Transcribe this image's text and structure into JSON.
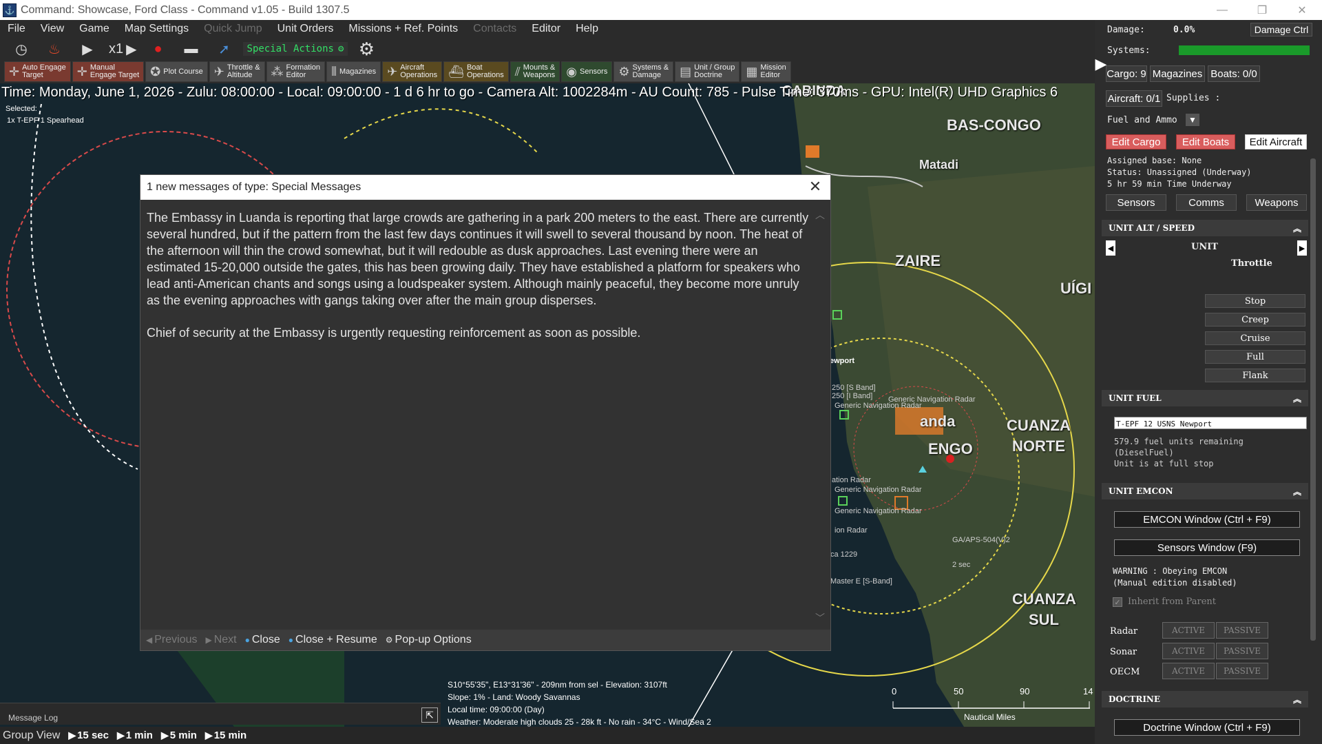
{
  "window": {
    "title": "Command: Showcase, Ford Class - Command v1.05 - Build 1307.5",
    "minimize": "—",
    "maximize": "❐",
    "close": "✕"
  },
  "menu": [
    "File",
    "View",
    "Game",
    "Map Settings",
    "Quick Jump",
    "Unit Orders",
    "Missions + Ref. Points",
    "Contacts",
    "Editor",
    "Help"
  ],
  "toolbar": {
    "speed": "x1",
    "special_actions": "Special Actions"
  },
  "toolbar2": [
    {
      "label1": "Auto Engage",
      "label2": "Target",
      "style": "red"
    },
    {
      "label1": "Manual",
      "label2": "Engage Target",
      "style": "red"
    },
    {
      "label1": "Plot Course",
      "label2": "",
      "style": ""
    },
    {
      "label1": "Throttle &",
      "label2": "Altitude",
      "style": ""
    },
    {
      "label1": "Formation",
      "label2": "Editor",
      "style": ""
    },
    {
      "label1": "Magazines",
      "label2": "",
      "style": ""
    },
    {
      "label1": "Aircraft",
      "label2": "Operations",
      "style": "gold"
    },
    {
      "label1": "Boat",
      "label2": "Operations",
      "style": "gold"
    },
    {
      "label1": "Mounts &",
      "label2": "Weapons",
      "style": "green"
    },
    {
      "label1": "Sensors",
      "label2": "",
      "style": "green"
    },
    {
      "label1": "Systems &",
      "label2": "Damage",
      "style": ""
    },
    {
      "label1": "Unit / Group",
      "label2": "Doctrine",
      "style": ""
    },
    {
      "label1": "Mission",
      "label2": "Editor",
      "style": ""
    }
  ],
  "status_line": "Time: Monday, June 1, 2026 - Zulu: 08:00:00 - Local: 09:00:00 - 1 d 6 hr to go -  Camera Alt: 1002284m  - AU Count: 785 - Pulse Time: 370ms - GPU: Intel(R) UHD Graphics 6",
  "selected": {
    "label": "Selected:",
    "unit": "1x T-EPF 1 Spearhead"
  },
  "map_labels": {
    "cabinda": "CABINDA",
    "bas_congo": "BAS-CONGO",
    "matadi": "Matadi",
    "zaire": "ZAIRE",
    "uige": "UÍGI",
    "cuanza_norte_1": "CUANZA",
    "cuanza_norte_2": "NORTE",
    "cuanza_sul_1": "CUANZA",
    "cuanza_sul_2": "SUL",
    "luanda": "anda",
    "bengo": "ENGO",
    "newport": "ewport",
    "band1": "250 [S Band]",
    "band2": "250 [I Band]",
    "gen_radar1": "Generic Navigation Radar",
    "gen_radar2": "Generic Navigation Radar",
    "nav_radar": "ation Radar",
    "gen_radar3": "Generic Navigation Radar",
    "gen_radar4": "Generic Navigation Radar",
    "gen_radar5": "ion Radar",
    "ca1229": "ca 1229",
    "masterE": "Master E [S-Band]",
    "aps": "GA/APS-504(V)2",
    "two_sec": "2 sec",
    "nautical": "Nautical Miles"
  },
  "scale": {
    "t0": "0",
    "t1": "50",
    "t2": "90",
    "t3": "14"
  },
  "cursor_info": [
    "S10°55'35\", E13°31'36\" - 209nm from sel - Elevation: 3107ft",
    "Slope: 1%  - Land: Woody Savannas",
    "Local time: 09:00:00 (Day)",
    "Weather: Moderate high clouds 25 - 28k ft - No rain - 34°C - Wind/Sea 2"
  ],
  "message_log": "Message Log",
  "timebar": {
    "group_view": "Group View",
    "steps": [
      "15 sec",
      "1 min",
      "5 min",
      "15 min"
    ]
  },
  "dialog": {
    "title": "1 new messages of type: Special Messages",
    "para1": "The Embassy in Luanda is reporting that large crowds are gathering in a park 200 meters to the east. There are currently several hundred, but if the pattern from the last few days continues it will swell to several thousand by noon. The heat of the afternoon will thin the crowd somewhat, but it will redouble as dusk approaches. Last evening there were an estimated 15-20,000 outside the gates, this has been growing daily. They have established a platform for speakers who lead anti-American chants and songs using a loudspeaker system. Although mainly peaceful, they become more unruly as the evening approaches with gangs taking over after the main group disperses.",
    "para2": "Chief of security at the Embassy is urgently requesting reinforcement as soon as possible.",
    "previous": "Previous",
    "next": "Next",
    "close": "Close",
    "close_resume": "Close + Resume",
    "popup_options": "Pop-up Options"
  },
  "panel": {
    "damage_label": "Damage:",
    "damage_value": "0.0%",
    "damage_ctrl": "Damage Ctrl",
    "systems_label": "Systems:",
    "systems_pct": 100,
    "cargo": "Cargo: 9",
    "magazines": "Magazines",
    "boats": "Boats: 0/0",
    "aircraft": "Aircraft: 0/1",
    "supplies": "Supplies :",
    "supply_select": "Fuel and Ammo",
    "edit_cargo": "Edit Cargo",
    "edit_boats": "Edit Boats",
    "edit_aircraft": "Edit Aircraft",
    "assigned_base": "Assigned base: None",
    "status": "Status: Unassigned (Underway)",
    "time_underway": "5 hr 59 min Time Underway",
    "sensors": "Sensors",
    "comms": "Comms",
    "weapons": "Weapons",
    "alt_speed_header": "UNIT ALT / SPEED",
    "unit_label": "UNIT",
    "throttle_label": "Throttle",
    "throttle_options": [
      "Stop",
      "Creep",
      "Cruise",
      "Full",
      "Flank"
    ],
    "fuel_header": "UNIT FUEL",
    "fuel_unit": "T-EPF 12 USNS Newport",
    "fuel_line1": "579.9 fuel units remaining",
    "fuel_line2": "(DieselFuel)",
    "fuel_line3": "Unit is at full stop",
    "emcon_header": "UNIT EMCON",
    "emcon_window": "EMCON Window (Ctrl + F9)",
    "sensors_window": "Sensors Window (F9)",
    "warning1": "WARNING : Obeying EMCON",
    "warning2": "(Manual edition disabled)",
    "inherit": "Inherit from Parent",
    "radar": "Radar",
    "sonar": "Sonar",
    "oecm": "OECM",
    "active": "ACTIVE",
    "passive": "PASSIVE",
    "doctrine_header": "DOCTRINE",
    "doctrine_window": "Doctrine Window (Ctrl + F9)"
  },
  "colors": {
    "accent_green": "#33e066",
    "alert_red": "#d95d5d",
    "range_ring_yellow": "#e6d84a",
    "range_ring_red": "#d94a4a"
  }
}
